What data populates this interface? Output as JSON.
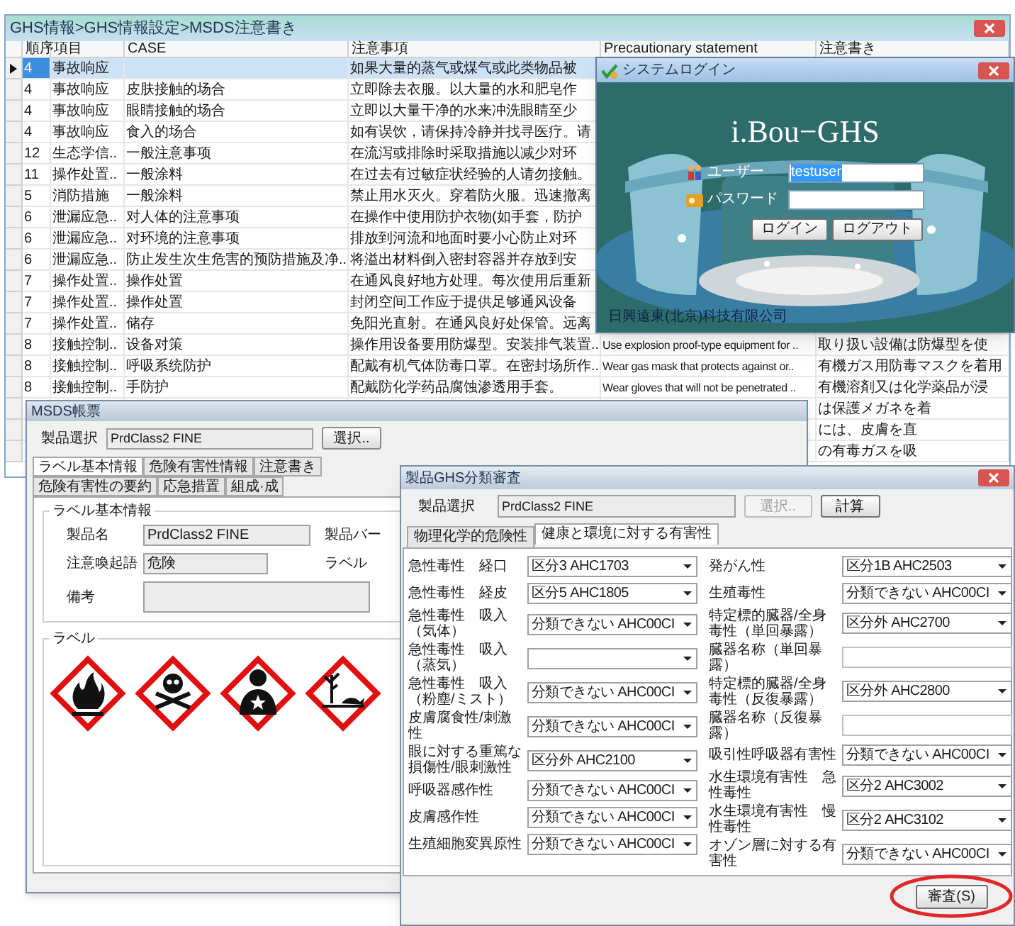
{
  "main_window": {
    "title": "GHS情報>GHS情報設定>MSDS注意書き",
    "columns": [
      "順序",
      "項目",
      "CASE",
      "注意事項",
      "Precautionary statement",
      "注意書き"
    ],
    "rows": [
      {
        "selected": true,
        "order": "4",
        "item": "事故响应",
        "caution_cn": "如果大量的蒸气或煤气或此类物品被"
      },
      {
        "selected": false,
        "order": "4",
        "item": "事故响应",
        "case": "皮肤接触的场合",
        "caution_cn": "立即除去衣服。以大量的水和肥皂作"
      },
      {
        "selected": false,
        "order": "4",
        "item": "事故响应",
        "case": "眼睛接触的场合",
        "caution_cn": "立即以大量干净的水来冲洗眼睛至少"
      },
      {
        "selected": false,
        "order": "4",
        "item": "事故响应",
        "case": "食入的场合",
        "caution_cn": "如有误饮，请保持冷静并找寻医疗。请"
      },
      {
        "selected": false,
        "order": "12",
        "item": "生态学信..",
        "case": "一般注意事项",
        "caution_cn": "在流泻或排除时采取措施以减少对环"
      },
      {
        "selected": false,
        "order": "11",
        "item": "操作处置..",
        "case": "一般涂料",
        "caution_cn": "在过去有过敏症状经验的人请勿接触。"
      },
      {
        "selected": false,
        "order": "5",
        "item": "消防措施",
        "case": "一般涂料",
        "caution_cn": "禁止用水灭火。穿着防火服。迅速撤离"
      },
      {
        "selected": false,
        "order": "6",
        "item": "泄漏应急..",
        "case": "对人体的注意事项",
        "caution_cn": "在操作中使用防护衣物(如手套，防护"
      },
      {
        "selected": false,
        "order": "6",
        "item": "泄漏应急..",
        "case": "对环境的注意事项",
        "caution_cn": "排放到河流和地面时要小心防止对环"
      },
      {
        "selected": false,
        "order": "6",
        "item": "泄漏应急..",
        "case": "防止发生次生危害的预防措施及净..",
        "caution_cn": "将溢出材料倒入密封容器并存放到安"
      },
      {
        "selected": false,
        "order": "7",
        "item": "操作处置..",
        "case": "操作处置",
        "caution_cn": "在通风良好地方处理。每次使用后重新"
      },
      {
        "selected": false,
        "order": "7",
        "item": "操作处置..",
        "case": "操作处置",
        "caution_cn": "封闭空间工作应于提供足够通风设备"
      },
      {
        "selected": false,
        "order": "7",
        "item": "操作处置..",
        "case": "储存",
        "caution_cn": "免阳光直射。在通风良好处保管。远离"
      },
      {
        "selected": false,
        "order": "8",
        "item": "接触控制..",
        "case": "设备对策",
        "caution_cn": "操作用设备要用防爆型。安装排气装置..",
        "precautionary": "Use explosion proof-type equipment for ..",
        "caution_ja": "取り扱い設備は防爆型を使"
      },
      {
        "selected": false,
        "order": "8",
        "item": "接触控制..",
        "case": "呼吸系统防护",
        "caution_cn": "配戴有机气体防毒口罩。在密封场所作..",
        "precautionary": "Wear gas mask that protects against or..",
        "caution_ja": "有機ガス用防毒マスクを着用"
      },
      {
        "selected": false,
        "order": "8",
        "item": "接触控制..",
        "case": "手防护",
        "caution_cn": "配戴防化学药品腐蚀渗透用手套。",
        "precautionary": "Wear gloves that will not be penetrated ..",
        "caution_ja": "有機溶剤又は化学薬品が浸"
      },
      {
        "selected": false,
        "caution_ja": "は保護メガネを着"
      },
      {
        "selected": false,
        "caution_ja": "には、皮膚を直"
      },
      {
        "selected": false,
        "caution_ja": "の有毒ガスを吸"
      }
    ]
  },
  "login_dialog": {
    "title": "システムログイン",
    "app_name": "i.Bou−GHS",
    "fields": [
      {
        "kind": "user",
        "label": "ユーザー",
        "value": "testuser",
        "text_selected": true
      },
      {
        "kind": "password",
        "label": "パスワード"
      }
    ],
    "buttons": [
      "ログイン",
      "ログアウト"
    ],
    "company": "日興遠東(北京)科技有限公司"
  },
  "msds_window": {
    "title": "MSDS帳票",
    "product_label": "製品選択",
    "product": "PrdClass2 FINE",
    "select_button": "選択..",
    "tabs": [
      {
        "label": "ラベル基本情報",
        "selected": true
      },
      {
        "label": "危険有害性情報",
        "selected": false
      },
      {
        "label": "注意書き",
        "selected": false
      },
      {
        "label": "危険有害性の要約",
        "selected": false
      },
      {
        "label": "応急措置",
        "selected": false
      },
      {
        "label": "組成·成",
        "selected": false
      }
    ],
    "basic_group": {
      "title": "ラベル基本情報",
      "fields": [
        {
          "kind": "text",
          "label": "製品名",
          "value": "PrdClass2 FINE",
          "side_label": "製品バー"
        },
        {
          "kind": "text",
          "label": "注意喚起語",
          "value": "危険",
          "side_label": "ラベル"
        },
        {
          "kind": "textarea",
          "label": "備考"
        }
      ]
    },
    "label_group": {
      "title": "ラベル",
      "pictograms": [
        {
          "kind": "flame"
        },
        {
          "kind": "skull"
        },
        {
          "kind": "health"
        },
        {
          "kind": "environment"
        }
      ]
    }
  },
  "ghs_window": {
    "title": "製品GHS分類審査",
    "product_label": "製品選択",
    "product": "PrdClass2 FINE",
    "buttons": [
      {
        "label": "選択..",
        "disabled": true
      },
      {
        "label": "計算",
        "disabled": false
      }
    ],
    "tabs": [
      {
        "label": "物理化学的危険性",
        "selected": false
      },
      {
        "label": "健康と環境に対する有害性",
        "selected": true
      }
    ],
    "left_items": [
      {
        "kind": "dropdown",
        "label": "急性毒性　経口",
        "value": "区分3 AHC1703"
      },
      {
        "kind": "dropdown",
        "label": "急性毒性　経皮",
        "value": "区分5 AHC1805"
      },
      {
        "kind": "dropdown",
        "label": "急性毒性　吸入（気体）",
        "value": "分類できない AHC00CI"
      },
      {
        "kind": "dropdown",
        "label": "急性毒性　吸入（蒸気）"
      },
      {
        "kind": "dropdown",
        "label": "急性毒性　吸入（粉塵/ミスト）",
        "value": "分類できない AHC00CI"
      },
      {
        "kind": "dropdown",
        "label": "皮膚腐食性/刺激性",
        "value": "分類できない AHC00CI"
      },
      {
        "kind": "dropdown",
        "label": "眼に対する重篤な損傷性/眼刺激性",
        "value": "区分外 AHC2100"
      },
      {
        "kind": "dropdown",
        "label": "呼吸器感作性",
        "value": "分類できない AHC00CI"
      },
      {
        "kind": "dropdown",
        "label": "皮膚感作性",
        "value": "分類できない AHC00CI"
      },
      {
        "kind": "dropdown",
        "label": "生殖細胞変異原性",
        "value": "分類できない AHC00CI"
      }
    ],
    "right_items": [
      {
        "kind": "dropdown",
        "label": "発がん性",
        "value": "区分1B AHC2503"
      },
      {
        "kind": "dropdown",
        "label": "生殖毒性",
        "value": "分類できない AHC00CI"
      },
      {
        "kind": "dropdown",
        "label": "特定標的臓器/全身毒性（単回暴露）",
        "value": "区分外 AHC2700"
      },
      {
        "kind": "text",
        "label": "臓器名称（単回暴露）"
      },
      {
        "kind": "dropdown",
        "label": "特定標的臓器/全身毒性（反復暴露）",
        "value": "区分外 AHC2800"
      },
      {
        "kind": "text",
        "label": "臓器名称（反復暴露）"
      },
      {
        "kind": "dropdown",
        "label": "吸引性呼吸器有害性",
        "value": "分類できない AHC00CI"
      },
      {
        "kind": "dropdown",
        "label": "水生環境有害性　急性毒性",
        "value": "区分2 AHC3002"
      },
      {
        "kind": "dropdown",
        "label": "水生環境有害性　慢性毒性",
        "value": "区分2 AHC3102"
      },
      {
        "kind": "dropdown",
        "label": "オゾン層に対する有害性",
        "value": "分類できない AHC00CI"
      }
    ],
    "review_button": {
      "label": "審査(S)",
      "circled": true
    }
  }
}
